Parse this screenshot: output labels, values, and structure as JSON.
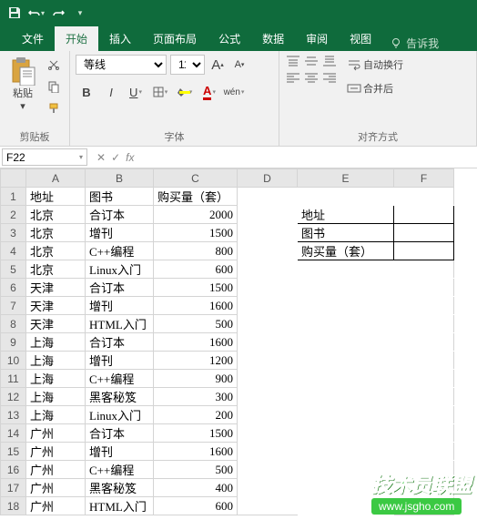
{
  "qat": {
    "save": "save",
    "undo": "undo",
    "redo": "redo"
  },
  "tabs": {
    "file": "文件",
    "home": "开始",
    "insert": "插入",
    "layout": "页面布局",
    "formula": "公式",
    "data": "数据",
    "review": "审阅",
    "view": "视图",
    "tell": "告诉我"
  },
  "ribbon": {
    "clipboard": {
      "paste": "粘贴",
      "label": "剪贴板"
    },
    "font": {
      "name": "等线",
      "size": "11",
      "label": "字体",
      "wen": "wén"
    },
    "align": {
      "wrap": "自动换行",
      "merge": "合并后",
      "label": "对齐方式"
    }
  },
  "namebox": "F22",
  "fx": "fx",
  "headers": [
    "",
    "A",
    "B",
    "C",
    "D",
    "E",
    "F"
  ],
  "rows": [
    {
      "r": 1,
      "a": "地址",
      "b": "图书",
      "c": "购买量（套）",
      "d": "",
      "e": "",
      "f": ""
    },
    {
      "r": 2,
      "a": "北京",
      "b": "合订本",
      "c": "2000",
      "d": "",
      "e": "地址",
      "f": ""
    },
    {
      "r": 3,
      "a": "北京",
      "b": "增刊",
      "c": "1500",
      "d": "",
      "e": "图书",
      "f": ""
    },
    {
      "r": 4,
      "a": "北京",
      "b": "C++编程",
      "c": "800",
      "d": "",
      "e": "购买量（套）",
      "f": ""
    },
    {
      "r": 5,
      "a": "北京",
      "b": "Linux入门",
      "c": "600",
      "d": "",
      "e": "",
      "f": ""
    },
    {
      "r": 6,
      "a": "天津",
      "b": "合订本",
      "c": "1500",
      "d": "",
      "e": "",
      "f": ""
    },
    {
      "r": 7,
      "a": "天津",
      "b": "增刊",
      "c": "1600",
      "d": "",
      "e": "",
      "f": ""
    },
    {
      "r": 8,
      "a": "天津",
      "b": "HTML入门",
      "c": "500",
      "d": "",
      "e": "",
      "f": ""
    },
    {
      "r": 9,
      "a": "上海",
      "b": "合订本",
      "c": "1600",
      "d": "",
      "e": "",
      "f": ""
    },
    {
      "r": 10,
      "a": "上海",
      "b": "增刊",
      "c": "1200",
      "d": "",
      "e": "",
      "f": ""
    },
    {
      "r": 11,
      "a": "上海",
      "b": "C++编程",
      "c": "900",
      "d": "",
      "e": "",
      "f": ""
    },
    {
      "r": 12,
      "a": "上海",
      "b": "黑客秘笈",
      "c": "300",
      "d": "",
      "e": "",
      "f": ""
    },
    {
      "r": 13,
      "a": "上海",
      "b": "Linux入门",
      "c": "200",
      "d": "",
      "e": "",
      "f": ""
    },
    {
      "r": 14,
      "a": "广州",
      "b": "合订本",
      "c": "1500",
      "d": "",
      "e": "",
      "f": ""
    },
    {
      "r": 15,
      "a": "广州",
      "b": "增刊",
      "c": "1600",
      "d": "",
      "e": "",
      "f": ""
    },
    {
      "r": 16,
      "a": "广州",
      "b": "C++编程",
      "c": "500",
      "d": "",
      "e": "",
      "f": ""
    },
    {
      "r": 17,
      "a": "广州",
      "b": "黑客秘笈",
      "c": "400",
      "d": "",
      "e": "",
      "f": ""
    },
    {
      "r": 18,
      "a": "广州",
      "b": "HTML入门",
      "c": "600",
      "d": "",
      "e": "",
      "f": ""
    }
  ],
  "watermark": {
    "title": "技术员联盟",
    "url": "www.jsgho.com"
  }
}
